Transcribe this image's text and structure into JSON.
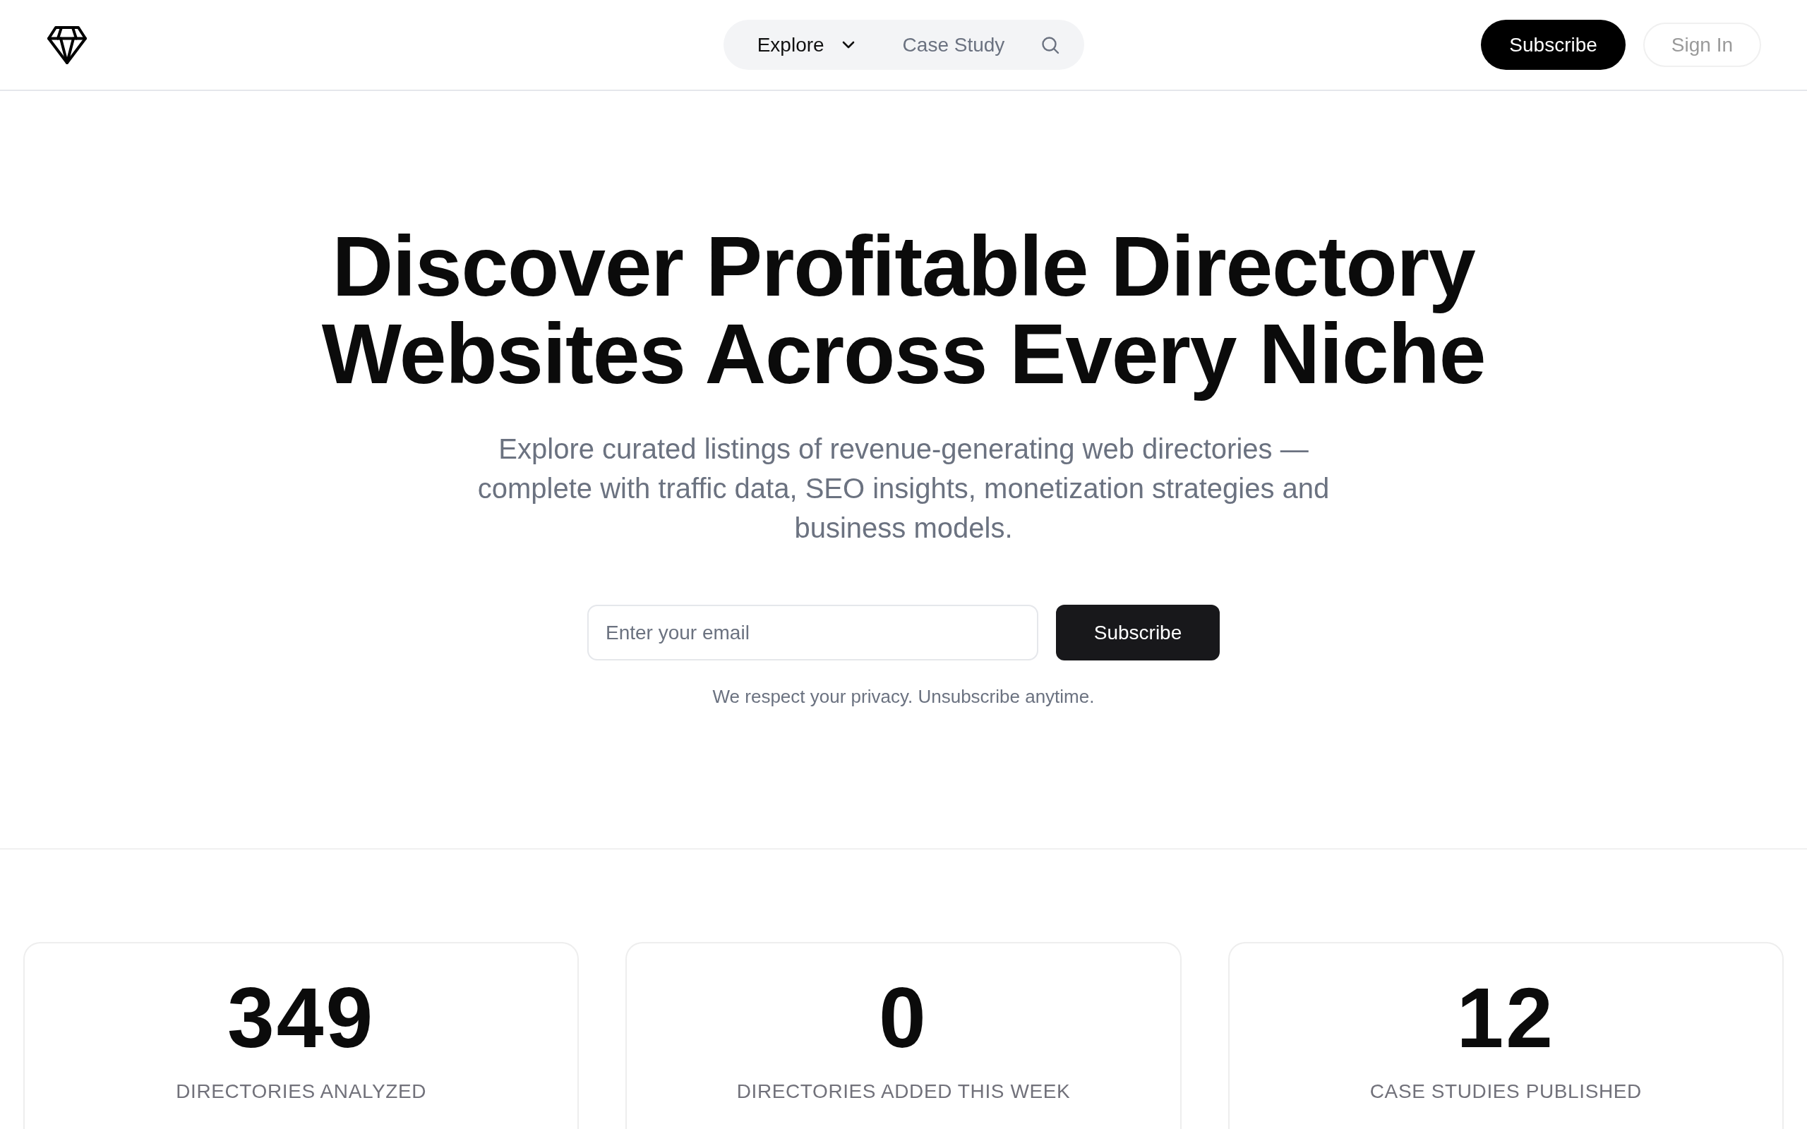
{
  "header": {
    "nav": [
      {
        "label": "Explore",
        "kind": "dropdown",
        "selected": true
      },
      {
        "label": "Case Study",
        "kind": "link",
        "selected": false
      }
    ],
    "actions": [
      {
        "label": "Subscribe",
        "kind": "primary"
      },
      {
        "label": "Sign In",
        "kind": "secondary"
      }
    ]
  },
  "hero": {
    "title": "Discover Profitable Directory Websites Across Every Niche",
    "subtitle": "Explore curated listings of revenue-generating web directories — complete with traffic data, SEO insights, monetization strategies and business models.",
    "email_form": {
      "placeholder": "Enter your email",
      "button": "Subscribe"
    },
    "note": "We respect your privacy. Unsubscribe anytime."
  },
  "stats": [
    {
      "value": "349",
      "label": "DIRECTORIES ANALYZED"
    },
    {
      "value": "0",
      "label": "DIRECTORIES ADDED THIS WEEK"
    },
    {
      "value": "12",
      "label": "CASE STUDIES PUBLISHED"
    }
  ]
}
